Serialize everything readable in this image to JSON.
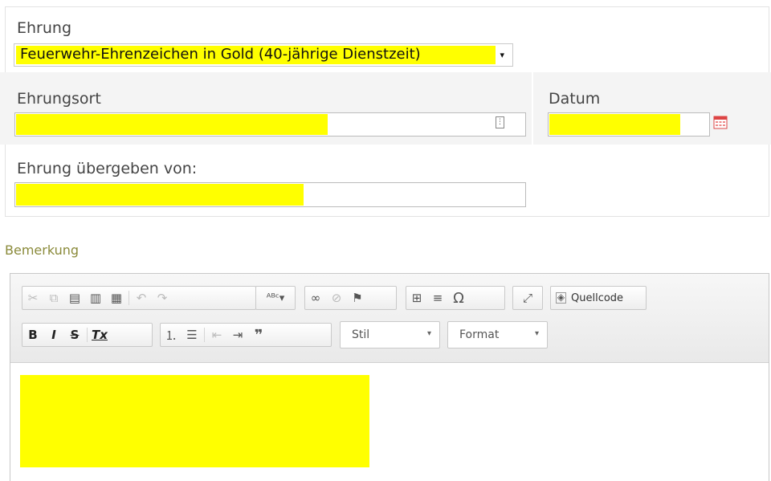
{
  "form": {
    "ehrung_label": "Ehrung",
    "ehrung_value": "Feuerwehr-Ehrenzeichen in Gold (40-jährige Dienstzeit)",
    "ehrung_arrow": "▾",
    "ehrungsort_label": "Ehrungsort",
    "datum_label": "Datum",
    "uebergeben_label": "Ehrung übergeben von:"
  },
  "bemerkung_label": "Bemerkung",
  "toolbar": {
    "row1": {
      "clipboard": [
        "cut-icon",
        "copy-icon",
        "paste-icon",
        "paste-text-icon",
        "paste-word-icon"
      ],
      "history": [
        "undo-icon",
        "redo-icon"
      ],
      "spellcheck": "spellcheck-icon",
      "links": [
        "link-icon",
        "unlink-icon",
        "anchor-icon"
      ],
      "insert": [
        "table-icon",
        "horizontal-line-icon",
        "special-char-icon"
      ],
      "maximize": "maximize-icon",
      "source_label": "Quellcode"
    },
    "row2": {
      "bold": "B",
      "italic": "I",
      "strike": "S",
      "remove_format": "Tx",
      "stil_label": "Stil",
      "format_label": "Format"
    }
  },
  "colors": {
    "highlight": "#ffff00",
    "bemerkung_label": "#8a8a3a"
  }
}
